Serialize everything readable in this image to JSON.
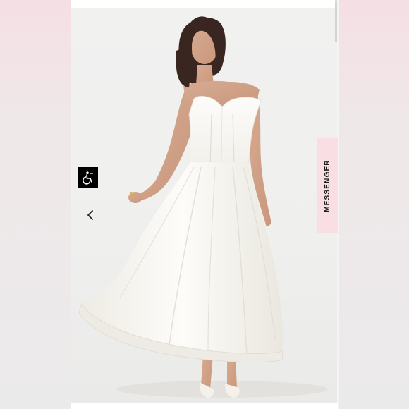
{
  "page": {
    "background_color": "#f1eeee",
    "accent_color": "#f9dfe3"
  },
  "product_image": {
    "alt": "",
    "dress_color": "#fbfaf7",
    "hair_color": "#3a2620"
  },
  "accessibility_button": {
    "icon": "wheelchair-icon",
    "background": "#000000"
  },
  "carousel": {
    "prev_icon": "chevron-left-icon"
  },
  "messenger_tab": {
    "label": "MESSENGER",
    "background": "#f9dfe3"
  }
}
